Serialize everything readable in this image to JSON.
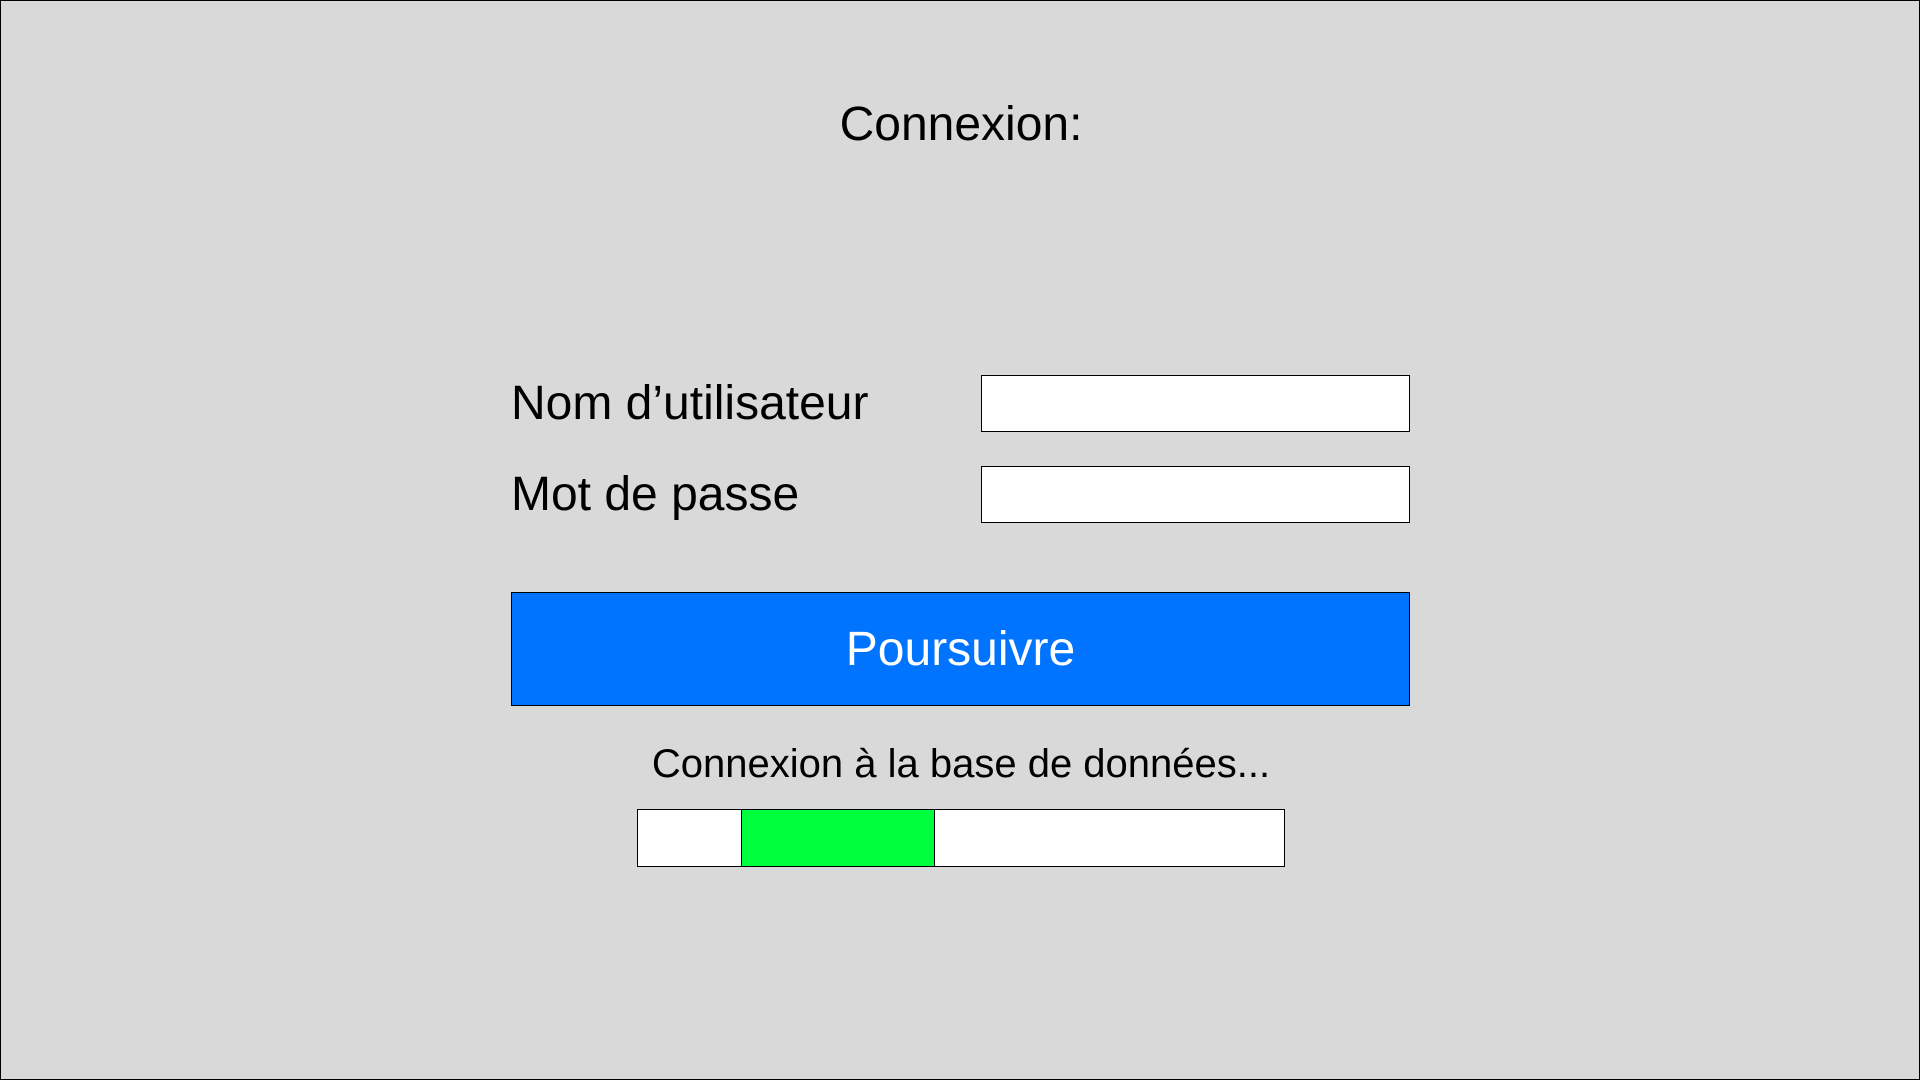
{
  "login": {
    "title": "Connexion:",
    "username_label": "Nom d’utilisateur",
    "username_value": "",
    "password_label": "Mot de passe",
    "password_value": "",
    "continue_label": "Poursuivre"
  },
  "status": {
    "message": "Connexion à la base de données...",
    "progress": {
      "style": "indeterminate",
      "segment_start_fraction": 0.16,
      "segment_end_fraction": 0.46,
      "fill_color": "#00ff3c"
    }
  },
  "colors": {
    "background": "#d9d9d9",
    "accent": "#0073ff",
    "progress": "#00ff3c"
  }
}
